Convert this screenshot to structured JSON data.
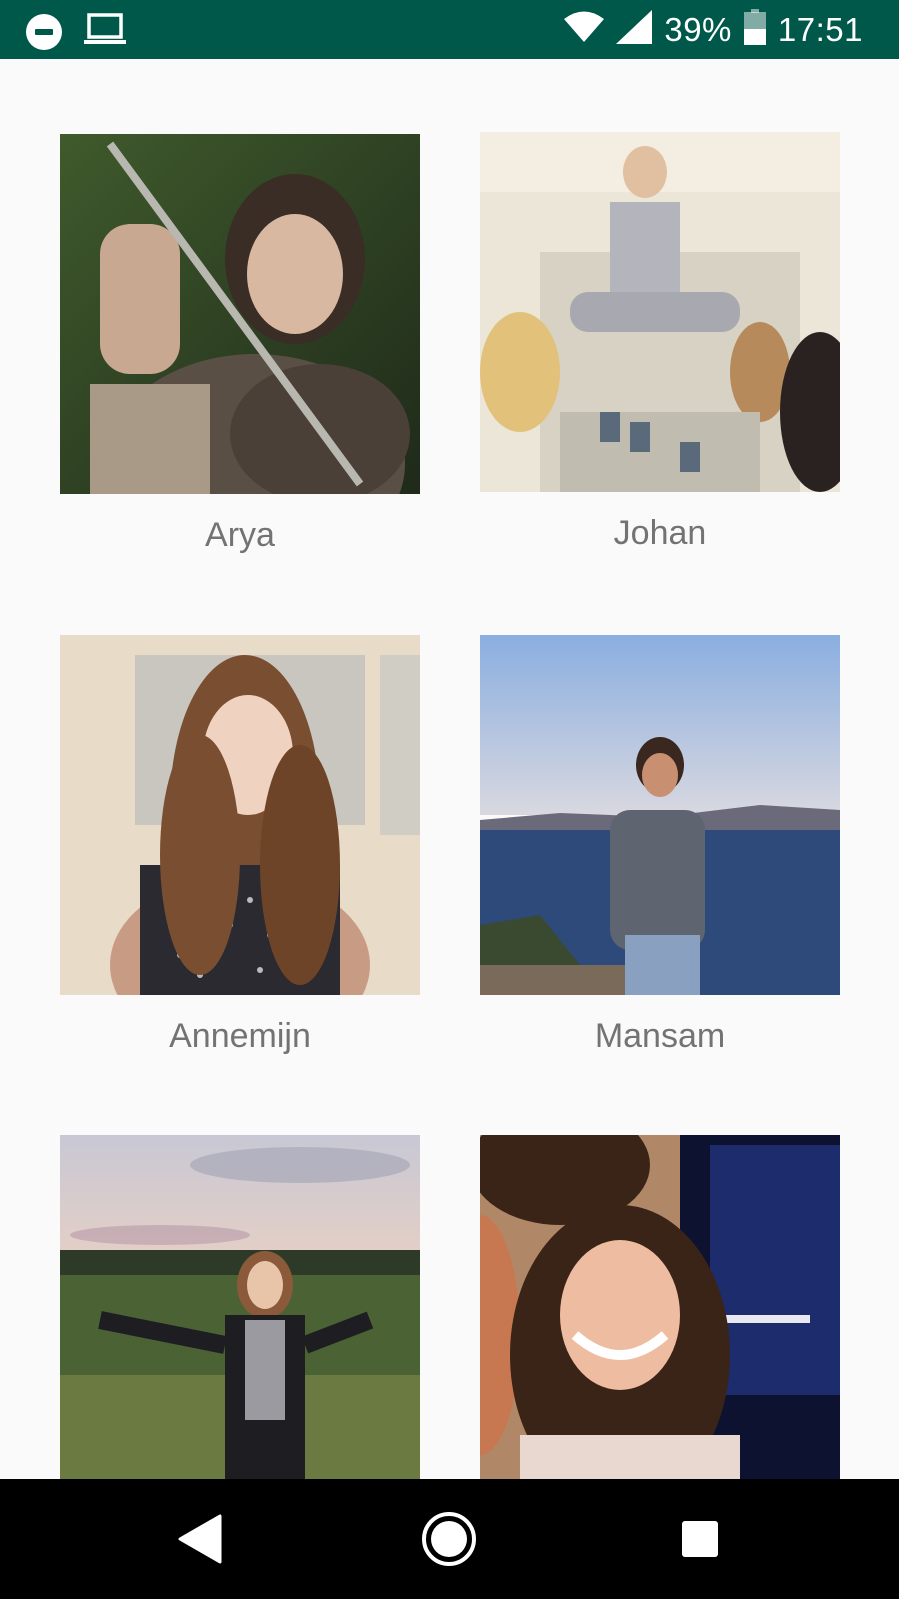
{
  "status_bar": {
    "battery_percent": "39%",
    "time": "17:51",
    "icons": [
      "do-not-disturb-icon",
      "laptop-icon",
      "wifi-icon",
      "signal-icon",
      "battery-icon"
    ]
  },
  "contacts": [
    {
      "name": "Arya"
    },
    {
      "name": "Johan"
    },
    {
      "name": "Annemijn"
    },
    {
      "name": "Mansam"
    },
    {
      "name": ""
    },
    {
      "name": ""
    }
  ],
  "nav_bar": {
    "icons": [
      "back-icon",
      "home-icon",
      "recents-icon"
    ]
  },
  "colors": {
    "status_bar": "#00584a",
    "background": "#fafafa",
    "label": "#737373",
    "nav_bar": "#000000"
  }
}
